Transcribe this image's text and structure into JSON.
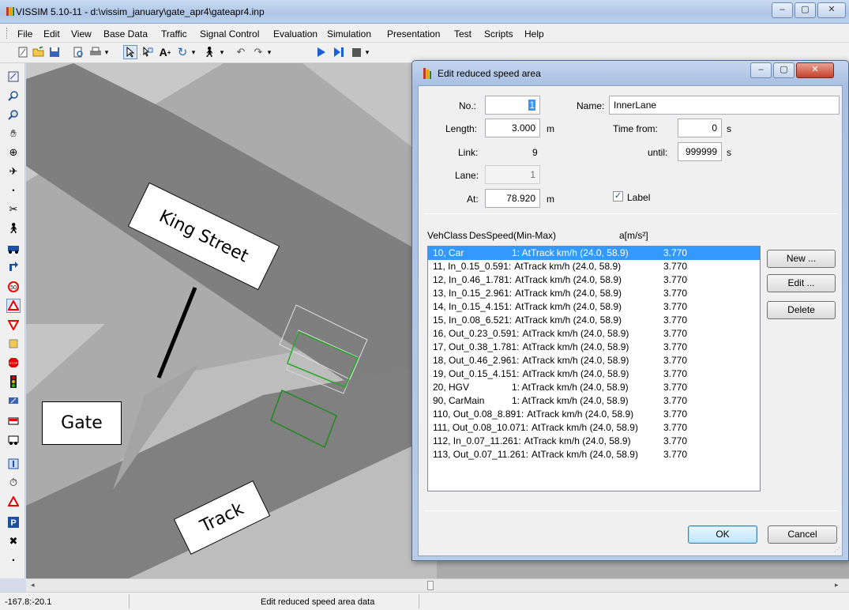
{
  "window": {
    "title": "VISSIM 5.10-11 - d:\\vissim_january\\gate_apr4\\gateapr4.inp",
    "minimize": "–",
    "restore": "▢",
    "close": "✕"
  },
  "menu": [
    "File",
    "Edit",
    "View",
    "Base Data",
    "Traffic",
    "Signal Control",
    "Evaluation",
    "Simulation",
    "Presentation",
    "Test",
    "Scripts",
    "Help"
  ],
  "canvas": {
    "labels": {
      "king_street": "King Street",
      "gate": "Gate",
      "track": "Track"
    },
    "colors": {
      "background": "#ababab",
      "road": "#7f7f7f",
      "area_light": "#c2c2c2",
      "speed_area": "#22a822"
    }
  },
  "dialog": {
    "title": "Edit reduced speed area",
    "no_label": "No.:",
    "no_value": "1",
    "name_label": "Name:",
    "name_value": "InnerLane",
    "length_label": "Length:",
    "length_value": "3.000",
    "length_unit": "m",
    "time_from_label": "Time  from:",
    "time_from_value": "0",
    "time_from_unit": "s",
    "link_label": "Link:",
    "link_value": "9",
    "until_label": "until:",
    "until_value": "999999",
    "until_unit": "s",
    "lane_label": "Lane:",
    "lane_value": "1",
    "at_label": "At:",
    "at_value": "78.920",
    "at_unit": "m",
    "label_checkbox": "Label",
    "label_checked": true,
    "col_vehclass": "VehClass",
    "col_desspeed": "DesSpeed(Min-Max)",
    "col_accel": "a[m/s²]",
    "rows": [
      {
        "cls": "10, Car",
        "speed": "1: AtTrack km/h (24.0, 58.9)",
        "accel": "3.770",
        "selected": true
      },
      {
        "cls": "11, In_0.15_0.591:",
        "speed": "AtTrack km/h (24.0, 58.9)",
        "accel": "3.770"
      },
      {
        "cls": "12, In_0.46_1.781:",
        "speed": "AtTrack km/h (24.0, 58.9)",
        "accel": "3.770"
      },
      {
        "cls": "13, In_0.15_2.961:",
        "speed": "AtTrack km/h (24.0, 58.9)",
        "accel": "3.770"
      },
      {
        "cls": "14, In_0.15_4.151:",
        "speed": "AtTrack km/h (24.0, 58.9)",
        "accel": "3.770"
      },
      {
        "cls": "15, In_0.08_6.521:",
        "speed": "AtTrack km/h (24.0, 58.9)",
        "accel": "3.770"
      },
      {
        "cls": "16, Out_0.23_0.591:",
        "speed": "AtTrack km/h (24.0, 58.9)",
        "accel": "3.770"
      },
      {
        "cls": "17, Out_0.38_1.781:",
        "speed": "AtTrack km/h (24.0, 58.9)",
        "accel": "3.770"
      },
      {
        "cls": "18, Out_0.46_2.961:",
        "speed": "AtTrack km/h (24.0, 58.9)",
        "accel": "3.770"
      },
      {
        "cls": "19, Out_0.15_4.151:",
        "speed": "AtTrack km/h (24.0, 58.9)",
        "accel": "3.770"
      },
      {
        "cls": "20, HGV",
        "speed": "1: AtTrack km/h (24.0, 58.9)",
        "accel": "3.770"
      },
      {
        "cls": "90, CarMain",
        "speed": "1: AtTrack km/h (24.0, 58.9)",
        "accel": "3.770"
      },
      {
        "cls": "110, Out_0.08_8.891:",
        "speed": "AtTrack km/h (24.0, 58.9)",
        "accel": "3.770"
      },
      {
        "cls": "111, Out_0.08_10.071:",
        "speed": "AtTrack km/h (24.0, 58.9)",
        "accel": "3.770"
      },
      {
        "cls": "112, In_0.07_11.261:",
        "speed": "AtTrack km/h (24.0, 58.9)",
        "accel": "3.770"
      },
      {
        "cls": "113, Out_0.07_11.261:",
        "speed": "AtTrack km/h (24.0, 58.9)",
        "accel": "3.770"
      }
    ],
    "new_button": "New ...",
    "edit_button": "Edit ...",
    "delete_button": "Delete",
    "ok_button": "OK",
    "cancel_button": "Cancel"
  },
  "status": {
    "coords": "-167.8:-20.1",
    "message": "Edit reduced speed area data"
  }
}
